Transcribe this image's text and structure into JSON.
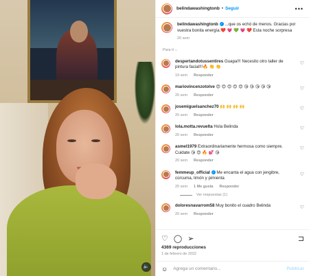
{
  "header": {
    "username": "belindawashingtonb",
    "separator": "•",
    "follow_label": "Seguir",
    "more_icon": "more-horizontal-icon"
  },
  "caption": {
    "username": "belindawashingtonb",
    "text": "...que os echó de menos. Gracias por vuestra bonita energía.❤️ 💗 💚 💗 ❤️ Esta noche sorpresa",
    "time": "20 sem"
  },
  "filter_label": "Para ti ⌵",
  "comments": [
    {
      "user": "despertandotussentires",
      "text": "Guapa!!! Necesito otro taller de pintura facial!!!🔥 👏 👏",
      "time": "19 sem",
      "reply": "Responder"
    },
    {
      "user": "mariovincenzotolve",
      "text": "😍 😍 😍 😍 😍 😘 😘 😘 😘 😘",
      "time": "20 sem",
      "reply": "Responder"
    },
    {
      "user": "josemiguelsanchez70",
      "text": "🙌 🙌 🙌 🙌",
      "time": "20 sem",
      "reply": "Responder"
    },
    {
      "user": "lola.motta.revuelta",
      "text": "Hola Belinda",
      "time": "20 sem",
      "reply": "Responder"
    },
    {
      "user": "asmel1979",
      "text": "Extraordinariamente hermosa como siempre. Cuidate 😘 😍 🔥 💕 😘",
      "time": "20 sem",
      "reply": "Responder"
    },
    {
      "user": "femmeup_official",
      "text": "Me encanta el agua con jengibre, cúrcuma, limón y pimienta",
      "time": "20 sem",
      "likes": "1 Me gusta",
      "reply": "Responder",
      "verified": "✓",
      "view_replies": "Ver respuestas (1)"
    },
    {
      "user": "doloresnavarrom58",
      "text": "Muy bonito el cuadro Belinda",
      "time": "20 sem",
      "reply": "Responder"
    }
  ],
  "footer": {
    "views": "4369 reproducciones",
    "date": "1 de febrero de 2022",
    "comment_placeholder": "Agrega un comentario...",
    "post_label": "Publicar"
  },
  "media": {
    "volume_icon": "🔈"
  },
  "colors": {
    "accent": "#0095f6",
    "muted": "#8e8e8e",
    "text": "#262626"
  }
}
